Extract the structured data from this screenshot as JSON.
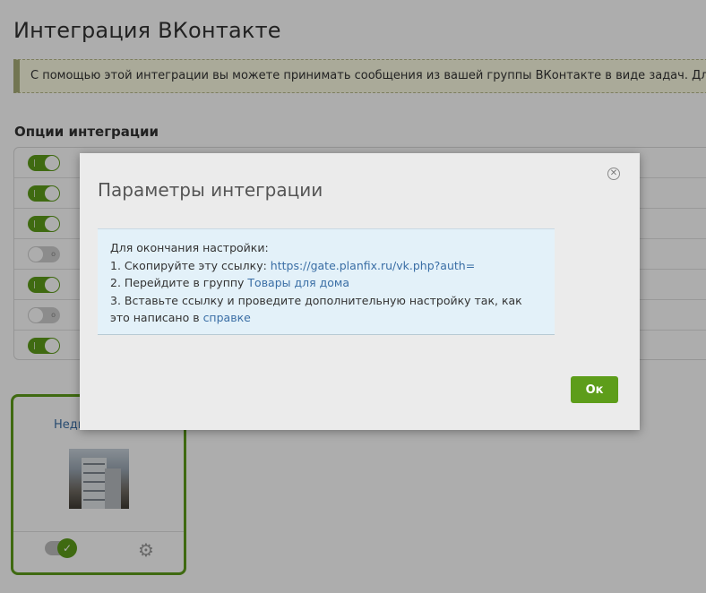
{
  "page": {
    "title": "Интеграция ВКонтакте",
    "info_banner": "С помощью этой интеграции вы можете принимать сообщения из вашей группы ВКонтакте в виде задач. Для подн",
    "options_title": "Опции интеграции"
  },
  "options": [
    {
      "state": "on"
    },
    {
      "state": "on"
    },
    {
      "state": "on"
    },
    {
      "state": "off"
    },
    {
      "state": "on"
    },
    {
      "state": "off"
    },
    {
      "state": "on"
    }
  ],
  "card": {
    "title": "Недв",
    "enabled": true,
    "settings_icon": "gear-icon"
  },
  "modal": {
    "title": "Параметры интеграции",
    "line1": "Для окончания настройки:",
    "line2_prefix": "1. Скопируйте эту ссылку: ",
    "line2_link": "https://gate.planfix.ru/vk.php?auth=",
    "line3_prefix": "2. Перейдите в группу ",
    "line3_link": "Товары для дома",
    "line4_prefix": "3. Вставьте ссылку и проведите дополнительную настройку так, как это написано в ",
    "line4_link": "справке",
    "ok_label": "Ок",
    "close_icon": "close-icon"
  },
  "colors": {
    "accent": "#5d9d1a",
    "link": "#3a6ea5",
    "info_bg": "#e3f1f9"
  }
}
